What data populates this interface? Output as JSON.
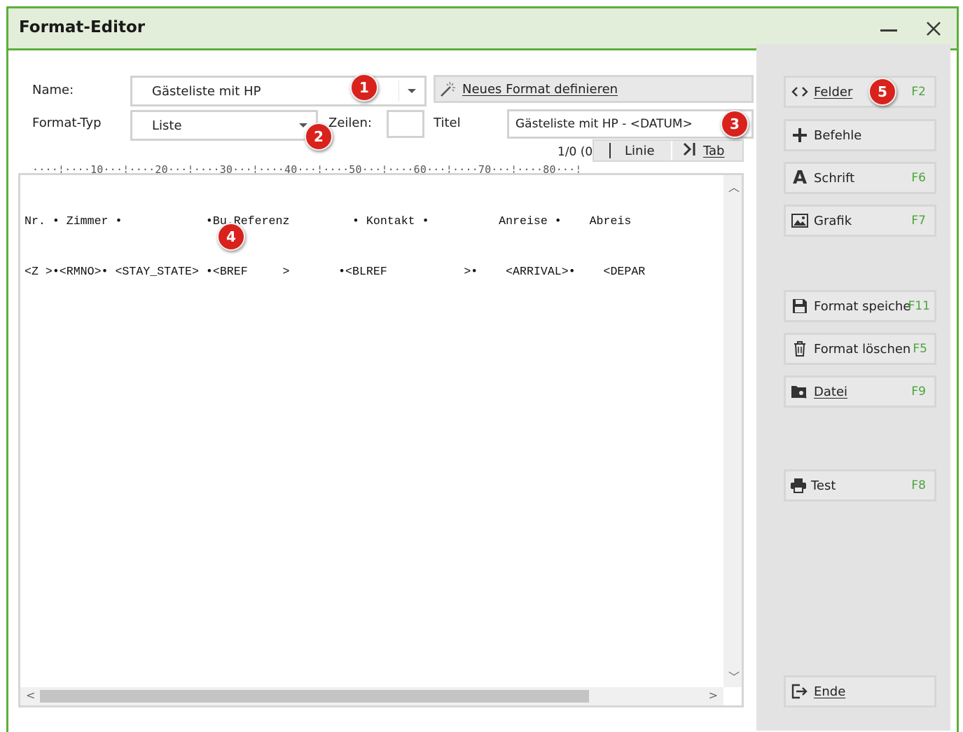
{
  "window": {
    "title": "Format-Editor"
  },
  "form": {
    "name_label": "Name:",
    "name_value": "Gästeliste mit HP",
    "type_label": "Format-Typ",
    "type_value": "Liste",
    "lines_label": "Zeilen:",
    "lines_value": "",
    "title_label": "Titel",
    "title_value": "Gästeliste mit HP - <DATUM>",
    "new_format_button": "Neues Format definieren"
  },
  "toolbar": {
    "position": "1/0 (0)",
    "line_button": "Linie",
    "tab_button": "Tab"
  },
  "ruler": "····¦····10···¦····20···¦····30···¦····40···¦····50···¦····60···¦····70···¦····80···¦",
  "editor": {
    "lines": [
      "Nr. • Zimmer •            •Bu.Referenz         • Kontakt •          Anreise •    Abreis",
      "<Z >•<RMNO>• <STAY_STATE> •<BREF     >       •<BLREF           >•    <ARRIVAL>•    <DEPAR"
    ]
  },
  "sidebar": {
    "buttons": [
      {
        "label": "Felder",
        "key": "F2",
        "icon": "code-icon"
      },
      {
        "label": "Befehle",
        "key": "",
        "icon": "plus-icon"
      },
      {
        "label": "Schrift",
        "key": "F6",
        "icon": "font-icon"
      },
      {
        "label": "Grafik",
        "key": "F7",
        "icon": "image-icon"
      },
      {
        "label": "Format speiche",
        "key": "F11",
        "icon": "save-icon"
      },
      {
        "label": "Format löschen",
        "key": "F5",
        "icon": "trash-icon"
      },
      {
        "label": "Datei",
        "key": "F9",
        "icon": "file-search-icon"
      },
      {
        "label": "Test",
        "key": "F8",
        "icon": "printer-icon"
      },
      {
        "label": "Ende",
        "key": "",
        "icon": "exit-icon"
      }
    ]
  },
  "annotations": [
    "1",
    "2",
    "3",
    "4",
    "5"
  ],
  "colors": {
    "accent_green": "#5daf3a",
    "titlebar_bg": "#e2eed9",
    "badge_red": "#d9221c",
    "shortcut_green": "#4aa53a"
  }
}
